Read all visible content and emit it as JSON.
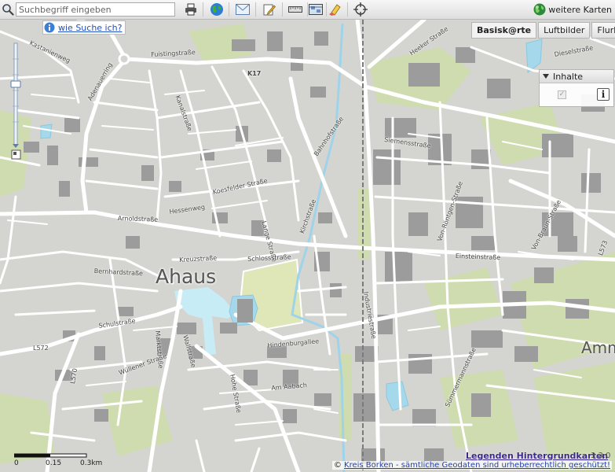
{
  "toolbar": {
    "search_placeholder": "Suchbegriff eingeben",
    "tools": [
      "print-icon",
      "globe-icon",
      "mail-icon",
      "edit-icon",
      "measure-icon",
      "map-icon",
      "eraser-icon",
      "crosshair-icon"
    ],
    "more_maps_label": "weitere Karten"
  },
  "help": {
    "label": "wie Suche ich?"
  },
  "base_layers": {
    "tabs": [
      "Basisk@rte",
      "Luftbilder",
      "Flurkarte"
    ],
    "active": "Basisk@rte"
  },
  "content_panel": {
    "title": "Inhalte"
  },
  "map": {
    "town": "Ahaus",
    "town_2": "Amm",
    "streets": [
      "Fuistingstraße",
      "Adenauerring",
      "Kanalstraße",
      "Hohe Straße",
      "Kirchstraße",
      "Lange Straße",
      "Koesfelder Straße",
      "Schulstraße",
      "Am Aabach",
      "Hindenburgallee",
      "Von-Braun-Straße",
      "Einsteinstraße",
      "Siemensstraße",
      "Industriestraße",
      "Von-Röntgen-Straße",
      "Bernhardstraße",
      "Wallstraße",
      "Kreuzstraße",
      "Marktstraße",
      "Schlossstraße",
      "Bahnhofstraße",
      "Wüllener Straße",
      "Sümmermannstraße",
      "Heeker Straße",
      "Dieselstraße",
      "Hessenweg",
      "Arnoldstraße",
      "Kastanienweg"
    ],
    "road_refs": [
      "K17",
      "L572",
      "L573",
      "L570"
    ]
  },
  "scale": {
    "labels": [
      "0",
      "0.15",
      "0.3km"
    ]
  },
  "footer": {
    "legend_link": "Legenden Hintergrundkarten",
    "version": "3.3.0",
    "copyright_prefix": "©",
    "copyright_link": "Kreis Borken - sämtliche Geodaten sind urheberrechtlich geschützt!"
  },
  "colors": {
    "map_background": "#d4d4d0",
    "road": "#ffffff",
    "water": "#a6d8ec",
    "building": "#9a9a9a",
    "green_area": "#cfdcb0",
    "pedestrian_zone": "#c8ecf5"
  }
}
